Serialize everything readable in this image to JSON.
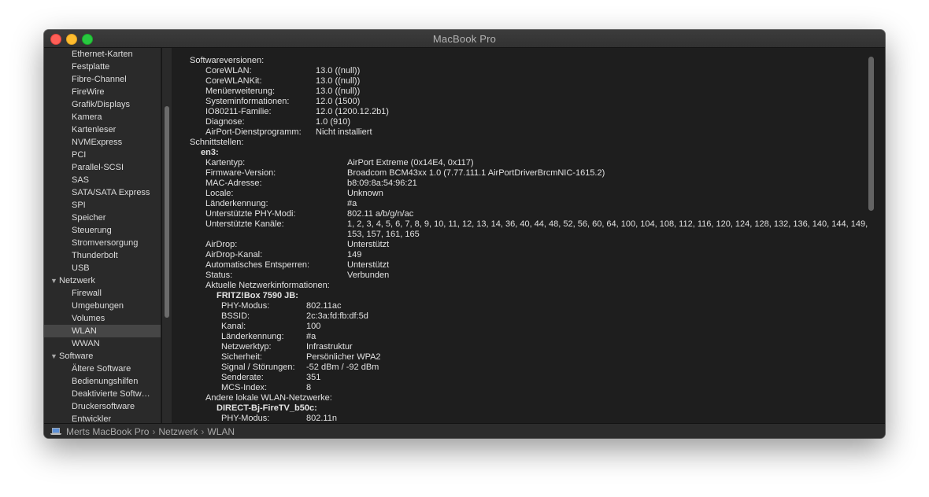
{
  "window": {
    "title": "MacBook Pro"
  },
  "sidebar": {
    "items": [
      {
        "label": "Ethernet-Karten",
        "type": "item"
      },
      {
        "label": "Festplatte",
        "type": "item"
      },
      {
        "label": "Fibre-Channel",
        "type": "item"
      },
      {
        "label": "FireWire",
        "type": "item"
      },
      {
        "label": "Grafik/Displays",
        "type": "item"
      },
      {
        "label": "Kamera",
        "type": "item"
      },
      {
        "label": "Kartenleser",
        "type": "item"
      },
      {
        "label": "NVMExpress",
        "type": "item"
      },
      {
        "label": "PCI",
        "type": "item"
      },
      {
        "label": "Parallel-SCSI",
        "type": "item"
      },
      {
        "label": "SAS",
        "type": "item"
      },
      {
        "label": "SATA/SATA Express",
        "type": "item"
      },
      {
        "label": "SPI",
        "type": "item"
      },
      {
        "label": "Speicher",
        "type": "item"
      },
      {
        "label": "Steuerung",
        "type": "item"
      },
      {
        "label": "Stromversorgung",
        "type": "item"
      },
      {
        "label": "Thunderbolt",
        "type": "item"
      },
      {
        "label": "USB",
        "type": "item"
      },
      {
        "label": "Netzwerk",
        "type": "group"
      },
      {
        "label": "Firewall",
        "type": "item"
      },
      {
        "label": "Umgebungen",
        "type": "item"
      },
      {
        "label": "Volumes",
        "type": "item"
      },
      {
        "label": "WLAN",
        "type": "item",
        "selected": true
      },
      {
        "label": "WWAN",
        "type": "item"
      },
      {
        "label": "Software",
        "type": "group"
      },
      {
        "label": "Ältere Software",
        "type": "item"
      },
      {
        "label": "Bedienungshilfen",
        "type": "item"
      },
      {
        "label": "Deaktivierte Softw…",
        "type": "item"
      },
      {
        "label": "Druckersoftware",
        "type": "item"
      },
      {
        "label": "Entwickler",
        "type": "item"
      }
    ]
  },
  "content": {
    "lines": [
      {
        "k": "Softwareversionen:",
        "v": "",
        "level": 0
      },
      {
        "k": "CoreWLAN:",
        "v": "13.0 ((null))",
        "level": 1
      },
      {
        "k": "CoreWLANKit:",
        "v": "13.0 ((null))",
        "level": 1
      },
      {
        "k": "Menüerweiterung:",
        "v": "13.0 ((null))",
        "level": 1
      },
      {
        "k": "Systeminformationen:",
        "v": "12.0 (1500)",
        "level": 1
      },
      {
        "k": "IO80211-Familie:",
        "v": "12.0 (1200.12.2b1)",
        "level": 1
      },
      {
        "k": "Diagnose:",
        "v": "1.0 (910)",
        "level": 1
      },
      {
        "k": "AirPort-Dienstprogramm:",
        "v": "Nicht installiert",
        "level": 1
      },
      {
        "k": "Schnittstellen:",
        "v": "",
        "level": 0
      },
      {
        "k": "en3:",
        "v": "",
        "level": "h1"
      },
      {
        "k": "Kartentyp:",
        "v": "AirPort Extreme  (0x14E4, 0x117)",
        "level": 2
      },
      {
        "k": "Firmware-Version:",
        "v": "Broadcom BCM43xx 1.0 (7.77.111.1 AirPortDriverBrcmNIC-1615.2)",
        "level": 2
      },
      {
        "k": "MAC-Adresse:",
        "v": "b8:09:8a:54:96:21",
        "level": 2
      },
      {
        "k": "Locale:",
        "v": "Unknown",
        "level": 2
      },
      {
        "k": "Länderkennung:",
        "v": "#a",
        "level": 2
      },
      {
        "k": "Unterstützte PHY-Modi:",
        "v": "802.11 a/b/g/n/ac",
        "level": 2
      },
      {
        "k": "Unterstützte Kanäle:",
        "v": "1, 2, 3, 4, 5, 6, 7, 8, 9, 10, 11, 12, 13, 14, 36, 40, 44, 48, 52, 56, 60, 64, 100, 104, 108, 112, 116, 120, 124, 128, 132, 136, 140, 144, 149, 153, 157, 161, 165",
        "level": 2,
        "wrap": true
      },
      {
        "k": "AirDrop:",
        "v": "Unterstützt",
        "level": 2
      },
      {
        "k": "AirDrop-Kanal:",
        "v": "149",
        "level": 2
      },
      {
        "k": "Automatisches Entsperren:",
        "v": "Unterstützt",
        "level": 2
      },
      {
        "k": "Status:",
        "v": "Verbunden",
        "level": 2
      },
      {
        "k": "Aktuelle Netzwerkinformationen:",
        "v": "",
        "level": 2
      },
      {
        "k": "FRITZ!Box 7590 JB:",
        "v": "",
        "level": "h2"
      },
      {
        "k": "PHY-Modus:",
        "v": "802.11ac",
        "level": 3
      },
      {
        "k": "BSSID:",
        "v": "2c:3a:fd:fb:df:5d",
        "level": 3
      },
      {
        "k": "Kanal:",
        "v": "100",
        "level": 3
      },
      {
        "k": "Länderkennung:",
        "v": "#a",
        "level": 3
      },
      {
        "k": "Netzwerktyp:",
        "v": "Infrastruktur",
        "level": 3
      },
      {
        "k": "Sicherheit:",
        "v": "Persönlicher WPA2",
        "level": 3
      },
      {
        "k": "Signal / Störungen:",
        "v": "-52 dBm / -92 dBm",
        "level": 3
      },
      {
        "k": "Senderate:",
        "v": "351",
        "level": 3
      },
      {
        "k": "MCS-Index:",
        "v": "8",
        "level": 3
      },
      {
        "k": "Andere lokale WLAN-Netzwerke:",
        "v": "",
        "level": 2
      },
      {
        "k": "DIRECT-Bj-FireTV_b50c:",
        "v": "",
        "level": "h2"
      },
      {
        "k": "PHY-Modus:",
        "v": "802.11n",
        "level": 3
      }
    ]
  },
  "statusbar": {
    "crumbs": [
      "Merts MacBook Pro",
      "Netzwerk",
      "WLAN"
    ],
    "separator": "›"
  }
}
